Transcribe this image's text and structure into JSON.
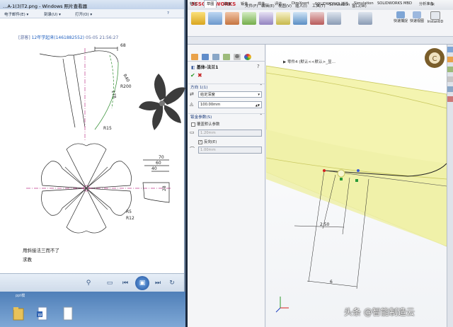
{
  "viewer": {
    "title": "…A-1(3)T2.png - Windows 照片查看器",
    "menu": [
      "电子邮件(E) ▾",
      "刻录(U) ▾",
      "打开(O) ▾"
    ],
    "post_tag": "[游客]",
    "post_user": "12年学起来(1461882552)",
    "post_time": "05-05 21:56:27",
    "comment1": "用斜接法三而不了",
    "comment2": "求教",
    "drawing_dims": {
      "d1": "68",
      "d2": "R40",
      "d3": "R200",
      "d4": "178",
      "d5": "R15",
      "d6": "70",
      "d7": "60",
      "d8": "40",
      "d9": "28",
      "d10": "R5",
      "d11": "R12"
    },
    "desktop_label": "ppt模"
  },
  "solidworks": {
    "logo_prefix": "3S",
    "logo_name": "SOLIDWORKS",
    "menu": [
      "文件(F)",
      "编辑(E)",
      "视图(V)",
      "插入(I)",
      "工具(T)",
      "Simulation",
      "窗口(W)"
    ],
    "ribbon_buttons": [
      "快速捕捉",
      "快速视图",
      "InstantID"
    ],
    "tabs": [
      "特征",
      "草图",
      "曲面",
      "钣金",
      "焊件",
      "评估",
      "DimXpert",
      "SOLIDWORKS 插件",
      "Simulation",
      "SOLIDWORKS MBD",
      "分析准备"
    ],
    "active_tab_index": 1,
    "breadcrumb": "▶ 零件4 (默认<<默认>_显…",
    "property_manager": {
      "feature_name": "基体-法兰1",
      "direction_section": "方向 1(1)",
      "end_condition": "给定深度",
      "depth": "100.00mm",
      "sheet_section": "钣金参数(S)",
      "override_label": "覆盖默认参数",
      "thickness": "1.20mm",
      "reverse_label": "反向(E)",
      "radius": "1.00mm"
    },
    "annotations": {
      "dim_a": "2.50",
      "dim_b": "6"
    }
  },
  "watermark": "头条 @智能制造云",
  "colors": {
    "part_yellow": "#f4f4b0",
    "sw_red": "#c9202b",
    "viewer_bar": "#cfdbea"
  }
}
